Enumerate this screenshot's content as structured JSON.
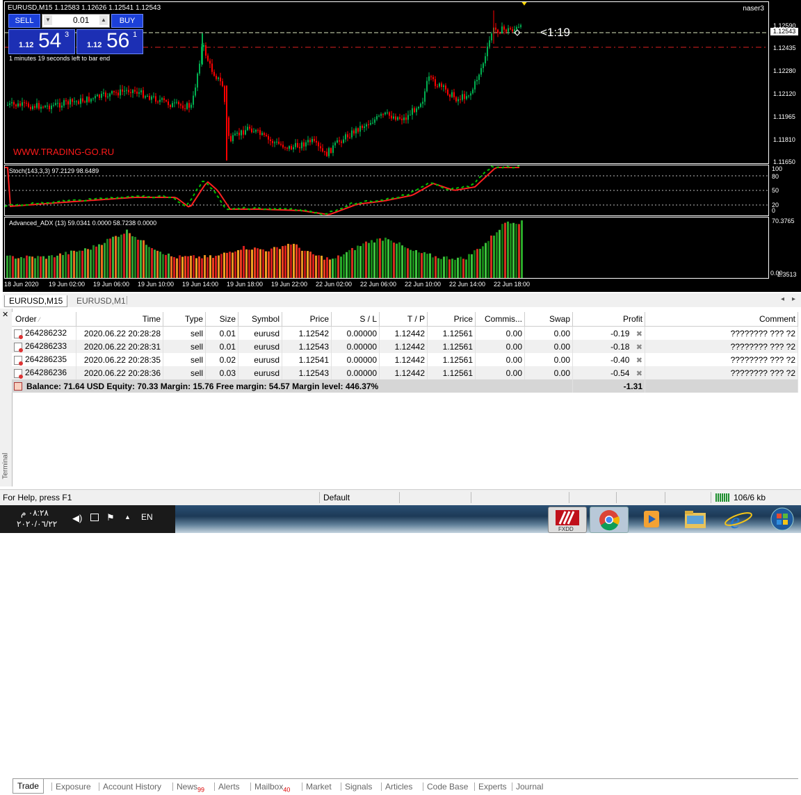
{
  "chart": {
    "title": "EURUSD,M15  1.12583 1.12626 1.12541 1.12543",
    "account": "naser3",
    "watermark": "WWW.TRADING-GO.RU",
    "bar_timer_text": "1 minutes 19 seconds left to bar end",
    "timer_label": "<1:19",
    "price_axis": [
      "1.12590",
      "1.12435",
      "1.12280",
      "1.12120",
      "1.11965",
      "1.11810",
      "1.11650"
    ],
    "current_price": "1.12543",
    "stoch_caption": "Stoch(143,3,3) 97.2129 98.6489",
    "stoch_axis": [
      "100",
      "80",
      "50",
      "20",
      "0"
    ],
    "adx_caption": "Advanced_ADX (13) 59.0341 0.0000 58.7238 0.0000",
    "adx_axis_top": "70.3765",
    "adx_axis_bottom": "2.3513",
    "adx_axis_zero": "0.00",
    "time_axis": [
      "18 Jun 2020",
      "19 Jun 02:00",
      "19 Jun 06:00",
      "19 Jun 10:00",
      "19 Jun 14:00",
      "19 Jun 18:00",
      "19 Jun 22:00",
      "22 Jun 02:00",
      "22 Jun 06:00",
      "22 Jun 10:00",
      "22 Jun 14:00",
      "22 Jun 18:00"
    ]
  },
  "one_click": {
    "sell_label": "SELL",
    "buy_label": "BUY",
    "volume": "0.01",
    "sell_prefix": "1.12",
    "sell_big": "54",
    "sell_sup": "3",
    "buy_prefix": "1.12",
    "buy_big": "56",
    "buy_sup": "1"
  },
  "chart_tabs": [
    "EURUSD,M15",
    "EURUSD,M1"
  ],
  "terminal": {
    "side_label": "Terminal",
    "columns": [
      "Order",
      "Time",
      "Type",
      "Size",
      "Symbol",
      "Price",
      "S / L",
      "T / P",
      "Price",
      "Commis...",
      "Swap",
      "Profit",
      "Comment"
    ],
    "rows": [
      {
        "order": "264286232",
        "time": "2020.06.22 20:28:28",
        "type": "sell",
        "size": "0.01",
        "symbol": "eurusd",
        "price": "1.12542",
        "sl": "0.00000",
        "tp": "1.12442",
        "cur": "1.12561",
        "comm": "0.00",
        "swap": "0.00",
        "profit": "-0.19",
        "comment": "???????? ??? ?2"
      },
      {
        "order": "264286233",
        "time": "2020.06.22 20:28:31",
        "type": "sell",
        "size": "0.01",
        "symbol": "eurusd",
        "price": "1.12543",
        "sl": "0.00000",
        "tp": "1.12442",
        "cur": "1.12561",
        "comm": "0.00",
        "swap": "0.00",
        "profit": "-0.18",
        "comment": "???????? ??? ?2"
      },
      {
        "order": "264286235",
        "time": "2020.06.22 20:28:35",
        "type": "sell",
        "size": "0.02",
        "symbol": "eurusd",
        "price": "1.12541",
        "sl": "0.00000",
        "tp": "1.12442",
        "cur": "1.12561",
        "comm": "0.00",
        "swap": "0.00",
        "profit": "-0.40",
        "comment": "???????? ??? ?2"
      },
      {
        "order": "264286236",
        "time": "2020.06.22 20:28:36",
        "type": "sell",
        "size": "0.03",
        "symbol": "eurusd",
        "price": "1.12543",
        "sl": "0.00000",
        "tp": "1.12442",
        "cur": "1.12561",
        "comm": "0.00",
        "swap": "0.00",
        "profit": "-0.54",
        "comment": "???????? ??? ?2"
      }
    ],
    "summary": "Balance: 71.64 USD  Equity: 70.33  Margin: 15.76  Free margin: 54.57  Margin level: 446.37%",
    "summary_profit": "-1.31",
    "tabs": [
      {
        "label": "Trade",
        "badge": ""
      },
      {
        "label": "Exposure",
        "badge": ""
      },
      {
        "label": "Account History",
        "badge": ""
      },
      {
        "label": "News",
        "badge": "99"
      },
      {
        "label": "Alerts",
        "badge": ""
      },
      {
        "label": "Mailbox",
        "badge": "40"
      },
      {
        "label": "Market",
        "badge": ""
      },
      {
        "label": "Signals",
        "badge": ""
      },
      {
        "label": "Articles",
        "badge": ""
      },
      {
        "label": "Code Base",
        "badge": ""
      },
      {
        "label": "Experts",
        "badge": ""
      },
      {
        "label": "Journal",
        "badge": ""
      }
    ]
  },
  "statusbar": {
    "help": "For Help, press F1",
    "profile": "Default",
    "traffic": "106/6 kb"
  },
  "taskbar": {
    "time": "٠٨:٢٨ م",
    "date": "٢٠٢٠/٠٦/٢٢",
    "lang": "EN",
    "apps": [
      "fxdd-icon",
      "chrome-icon",
      "media-player-icon",
      "folder-icon",
      "ie-icon",
      "windows-start-icon"
    ]
  },
  "colors": {
    "bull": "#00b050",
    "bear": "#ff0000",
    "stoch_main": "#00c000",
    "stoch_signal": "#ff2020",
    "oneclick_blue": "#1c40d8"
  }
}
